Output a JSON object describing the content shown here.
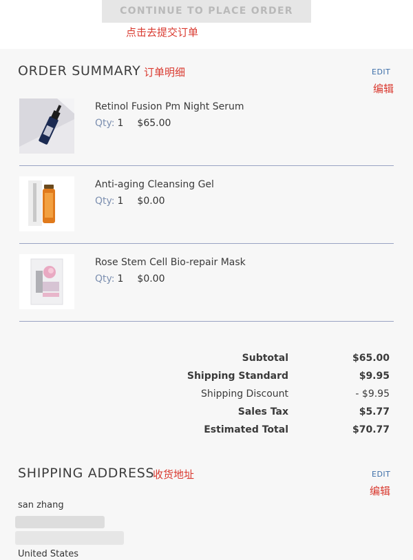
{
  "header": {
    "continue_button": "CONTINUE TO PLACE ORDER",
    "continue_annotation": "点击去提交订单"
  },
  "order_summary": {
    "title": "ORDER SUMMARY",
    "title_annotation": "订单明细",
    "edit_label": "EDIT",
    "edit_annotation": "编辑",
    "qty_label": "Qty:",
    "items": [
      {
        "name": "Retinol Fusion Pm Night Serum",
        "qty": "1",
        "price": "$65.00"
      },
      {
        "name": "Anti-aging Cleansing Gel",
        "qty": "1",
        "price": "$0.00"
      },
      {
        "name": "Rose Stem Cell Bio-repair Mask",
        "qty": "1",
        "price": "$0.00"
      }
    ]
  },
  "totals": [
    {
      "label": "Subtotal",
      "value": "$65.00"
    },
    {
      "label": "Shipping Standard",
      "value": "$9.95"
    },
    {
      "label": "Shipping Discount",
      "value": "- $9.95"
    },
    {
      "label": "Sales Tax",
      "value": "$5.77"
    },
    {
      "label": "Estimated Total",
      "value": "$70.77"
    }
  ],
  "shipping": {
    "title": "SHIPPING ADDRESS",
    "title_annotation": "收货地址",
    "edit_label": "EDIT",
    "edit_annotation": "编辑",
    "name": "san zhang",
    "country": "United States"
  },
  "colors": {
    "annotation": "#d9392f",
    "link": "#3c6ea8",
    "divider": "#98a2c2",
    "panel_bg": "#f7f7f7"
  }
}
